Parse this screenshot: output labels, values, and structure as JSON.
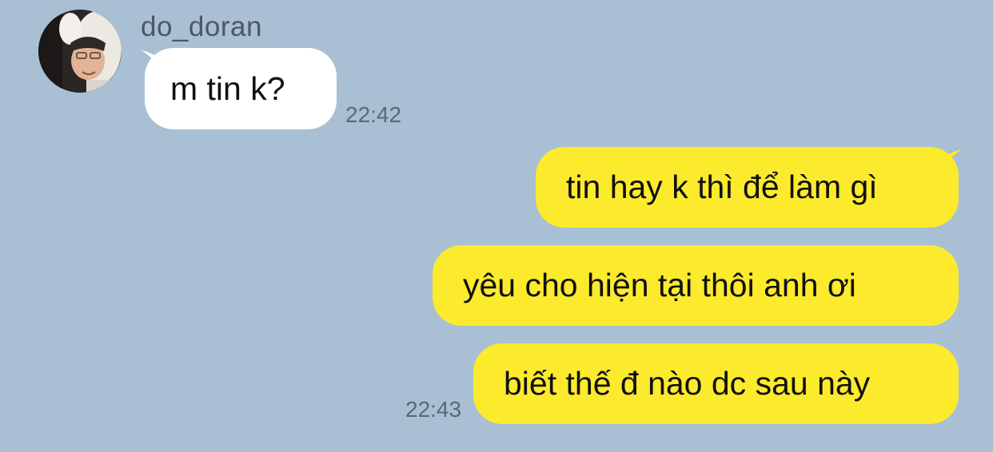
{
  "colors": {
    "background": "#a9bfd3",
    "incoming_bubble": "#ffffff",
    "outgoing_bubble": "#fcea2d",
    "name_text": "#4e5861",
    "time_text": "#5d6873"
  },
  "contact": {
    "name": "do_doran",
    "avatar_icon": "profile-photo-icon"
  },
  "messages": [
    {
      "direction": "incoming",
      "text": "m tin k?",
      "time": "22:42"
    },
    {
      "direction": "outgoing",
      "text": "tin hay k thì để làm gì",
      "time": ""
    },
    {
      "direction": "outgoing",
      "text": "yêu cho hiện tại thôi anh ơi",
      "time": ""
    },
    {
      "direction": "outgoing",
      "text": "biết thế đ nào dc sau này",
      "time": "22:43"
    }
  ]
}
